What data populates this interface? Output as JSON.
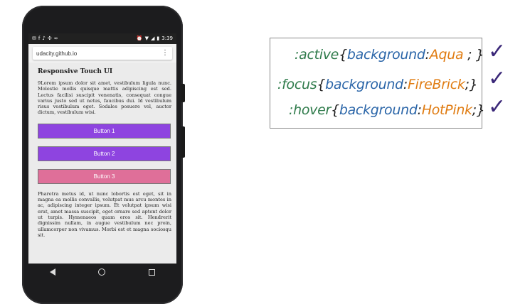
{
  "statusbar": {
    "left_icons": [
      "mail-icon",
      "facebook-icon",
      "twitter-icon",
      "pinwheel-icon",
      "voicemail-icon"
    ],
    "time": "3:39",
    "right_icons": [
      "alarm-icon",
      "wifi-icon",
      "signal-icon",
      "battery-icon"
    ]
  },
  "browser": {
    "url": "udacity.github.io",
    "menu": "⋮"
  },
  "page": {
    "title": "Responsive Touch UI",
    "paragraph1": "9Lorem ipsum dolor sit amet, vestibulum ligula nunc. Molestie mollis quisque mattis adipiscing est sed. Lectus facilisi suscipit venenatis, consequat congue varius justo sed ut netus, faucibus dui. Id vestibulum risus vestibulum eget. Sodales posuere vel, auctor dictum, vestibulum wisi.",
    "paragraph2": "Pharetra metus id, ut nunc lobortis est eget, sit in magna ea mollis convallis, volutpat mus arcu montes in ac, adipiscing integer ipsum. Et volutpat ipsum wisi erat, amet massa suscipit, eget ornare sed aptent dolor ut turpis. Hymenaeos quam eros sit. Hendrerit dignissim nullam, in augue vestibulum nec proin, ullamcorper non vivamus. Morbi est et magna sociosqu sit.",
    "buttons": [
      {
        "label": "Button 1",
        "color": "#8e44e0"
      },
      {
        "label": "Button 2",
        "color": "#8e44e0"
      },
      {
        "label": "Button 3",
        "color": "#df6f99"
      }
    ]
  },
  "css_rules": [
    {
      "selector": ":active",
      "open": "{",
      "property": "background",
      "colon": ":",
      "value": "Aqua",
      "end": ";",
      "close": "}",
      "check": "✓"
    },
    {
      "selector": ":focus",
      "open": "{",
      "property": "background",
      "colon": ":",
      "value": "FireBrick",
      "end": ";",
      "close": "}",
      "check": "✓"
    },
    {
      "selector": ":hover",
      "open": "{",
      "property": "background",
      "colon": ":",
      "value": "HotPink",
      "end": ";",
      "close": "}",
      "check": "✓"
    }
  ]
}
